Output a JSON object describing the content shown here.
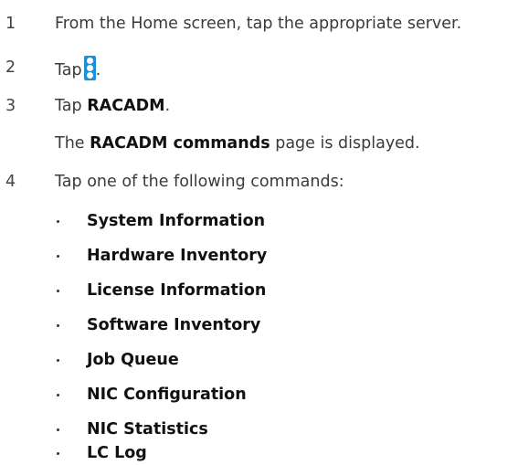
{
  "steps": [
    {
      "number": "1",
      "text": "From the Home screen, tap the appropriate server."
    },
    {
      "number": "2",
      "prefix": "Tap",
      "icon": "vertical-dots-menu-icon",
      "suffix": "."
    },
    {
      "number": "3",
      "prefix": "Tap ",
      "bold": "RACADM",
      "suffix": "."
    },
    {
      "sub_prefix": "The ",
      "sub_bold": "RACADM commands",
      "sub_suffix": " page is displayed."
    },
    {
      "number": "4",
      "text": "Tap one of the following commands:"
    }
  ],
  "commands": [
    "System Information",
    "Hardware Inventory",
    "License Information",
    "Software Inventory",
    "Job Queue",
    "NIC Configuration",
    "NIC Statistics",
    "LC Log"
  ],
  "colors": {
    "icon_blue": "#1d8fd9"
  }
}
